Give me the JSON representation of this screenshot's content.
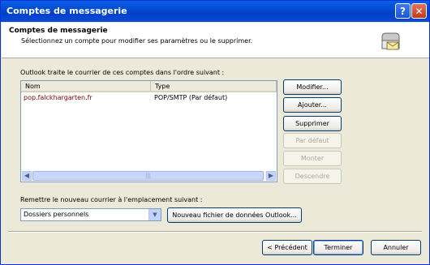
{
  "window": {
    "title": "Comptes de messagerie"
  },
  "header": {
    "title": "Comptes de messagerie",
    "subtitle": "Sélectionnez un compte pour modifier ses paramètres ou le supprimer."
  },
  "accounts": {
    "intro": "Outlook traite le courrier de ces comptes dans l'ordre suivant :",
    "columns": {
      "name": "Nom",
      "type": "Type"
    },
    "rows": [
      {
        "name": "pop.falckhargarten.fr",
        "type": "POP/SMTP (Par défaut)"
      }
    ]
  },
  "side_buttons": {
    "modify": "Modifier...",
    "add": "Ajouter...",
    "remove": "Supprimer",
    "default": "Par défaut",
    "up": "Monter",
    "down": "Descendre"
  },
  "delivery": {
    "label": "Remettre le nouveau courrier à l'emplacement suivant :",
    "selected": "Dossiers personnels",
    "new_file": "Nouveau fichier de données Outlook..."
  },
  "footer": {
    "back": "< Précédent",
    "finish": "Terminer",
    "cancel": "Annuler"
  }
}
